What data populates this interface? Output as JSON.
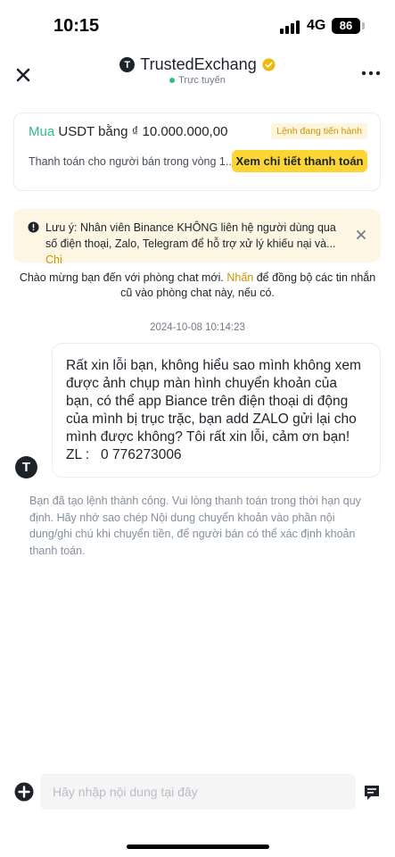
{
  "status_bar": {
    "time": "10:15",
    "network": "4G",
    "battery": "86"
  },
  "header": {
    "title": "TrustedExchang",
    "avatar_letter": "T",
    "online_status": "Trực tuyến"
  },
  "order_card": {
    "buy_word": "Mua",
    "title_rest": " USDT bằng ₫ 10.000.000,00",
    "status_badge": "Lệnh đang tiến hành",
    "subtitle": "Thanh toán cho người bán trong vòng 1...",
    "detail_button": "Xem chi tiết thanh toán"
  },
  "warning": {
    "text": "Lưu ý: Nhân viên Binance KHÔNG liên hệ người dùng qua số điện thoại, Zalo, Telegram để hỗ trợ xử lý khiếu nại và...",
    "more_link": "Chi"
  },
  "welcome": {
    "text_before": "Chào mừng bạn đến với phòng chat mới.",
    "link": "Nhấn",
    "text_after": "để đồng bộ các tin nhắn cũ vào phòng chat này, nếu có."
  },
  "chat": {
    "timestamp": "2024-10-08 10:14:23",
    "avatar_letter": "T",
    "message_lines": [
      "Rất xin lỗi bạn, không hiểu sao mình không xem",
      "được ảnh chụp màn hình chuyển khoản của",
      "bạn, có thể app Biance trên điện thoại di động",
      "của mình bị trục trặc, bạn add ZALO gửi lại cho",
      "mình được không? Tôi rất xin lỗi, cảm ơn bạn!",
      "ZL :   0 776273006"
    ],
    "system_note": "Bạn đã tạo lệnh thành công. Vui lòng thanh toán trong thời hạn quy định. Hãy nhớ sao chép Nội dung chuyển khoản vào phần nội dung/ghi chú khi chuyển tiền, để người bán có thể xác định khoản thanh toán."
  },
  "composer": {
    "placeholder": "Hãy nhập nội dung tại đây"
  },
  "colors": {
    "brand_yellow": "#fcd535",
    "buy_green": "#2ebd85",
    "link_gold": "#c99400",
    "warning_bg": "#fdf6e3"
  }
}
